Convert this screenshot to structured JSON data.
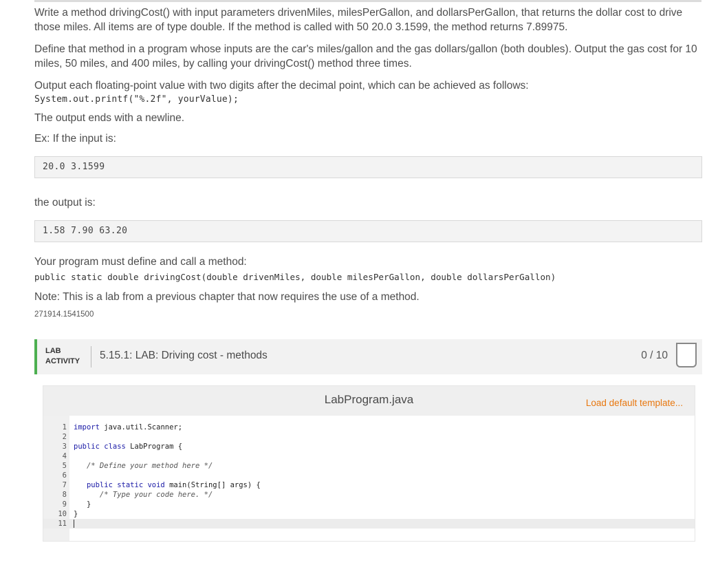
{
  "intro": {
    "p1": "Write a method drivingCost() with input parameters drivenMiles, milesPerGallon, and dollarsPerGallon, that returns the dollar cost to drive those miles. All items are of type double. If the method is called with 50 20.0 3.1599, the method returns 7.89975.",
    "p2": "Define that method in a program whose inputs are the car's miles/gallon and the gas dollars/gallon (both doubles). Output the gas cost for 10 miles, 50 miles, and 400 miles, by calling your drivingCost() method three times.",
    "p3": "Output each floating-point value with two digits after the decimal point, which can be achieved as follows:",
    "printf_code": "System.out.printf(\"%.2f\", yourValue);",
    "p4": "The output ends with a newline.",
    "p5": "Ex: If the input is:",
    "example_input": "20.0 3.1599",
    "p6": "the output is:",
    "example_output": "1.58 7.90 63.20",
    "p7": "Your program must define and call a method:",
    "signature": "public static double drivingCost(double drivenMiles, double milesPerGallon, double dollarsPerGallon)",
    "p8": "Note: This is a lab from a previous chapter that now requires the use of a method.",
    "id": "271914.1541500"
  },
  "lab": {
    "tag_line1": "LAB",
    "tag_line2": "ACTIVITY",
    "title": "5.15.1: LAB: Driving cost - methods",
    "score": "0 / 10"
  },
  "editor": {
    "file_name": "LabProgram.java",
    "load_template": "Load default template...",
    "lines": [
      {
        "n": "1",
        "text": "import java.util.Scanner;"
      },
      {
        "n": "2",
        "text": ""
      },
      {
        "n": "3",
        "text": "public class LabProgram {"
      },
      {
        "n": "4",
        "text": ""
      },
      {
        "n": "5",
        "text": "   /* Define your method here */"
      },
      {
        "n": "6",
        "text": ""
      },
      {
        "n": "7",
        "text": "   public static void main(String[] args) {"
      },
      {
        "n": "8",
        "text": "      /* Type your code here. */"
      },
      {
        "n": "9",
        "text": "   }"
      },
      {
        "n": "10",
        "text": "}"
      },
      {
        "n": "11",
        "text": ""
      }
    ]
  }
}
